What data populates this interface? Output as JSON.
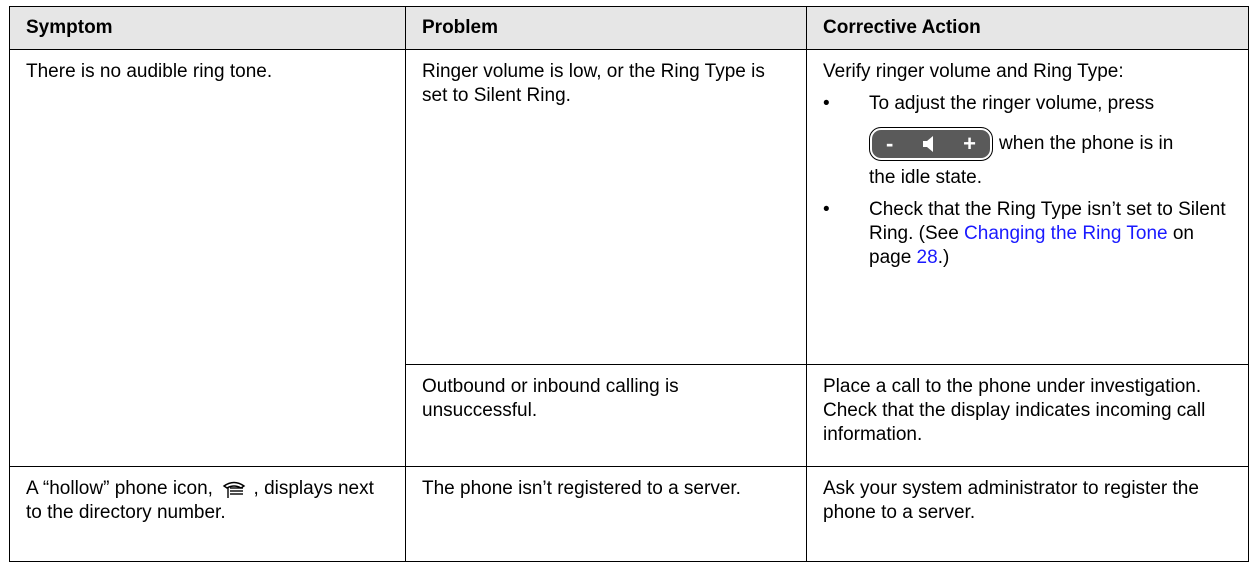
{
  "headers": {
    "symptom": "Symptom",
    "problem": "Problem",
    "action": "Corrective Action"
  },
  "row1": {
    "symptom": "There is no audible ring tone.",
    "problem1": "Ringer volume is low, or the Ring Type is set to Silent Ring.",
    "action1_intro": "Verify ringer volume and Ring Type:",
    "bullet_char": "•",
    "bullet1_pre": "To adjust the ringer volume, press",
    "bullet1_post": "when the phone is in",
    "bullet1_tail": "the idle state.",
    "vol_minus": "-",
    "vol_plus": "+",
    "bullet2_pre": "Check that the Ring Type isn’t set to Silent Ring. (See ",
    "bullet2_link": "Changing the Ring Tone",
    "bullet2_mid": " on page ",
    "bullet2_page": "28",
    "bullet2_post": ".)",
    "problem2": "Outbound or inbound calling is unsuccessful.",
    "action2": "Place a call to the phone under investigation. Check that the display indicates incoming call information."
  },
  "row2": {
    "symptom_pre": "A “hollow” phone icon,",
    "symptom_post": ", displays next to the directory number.",
    "problem": "The phone isn’t registered to a server.",
    "action": "Ask your system administrator to register the phone to a server."
  }
}
